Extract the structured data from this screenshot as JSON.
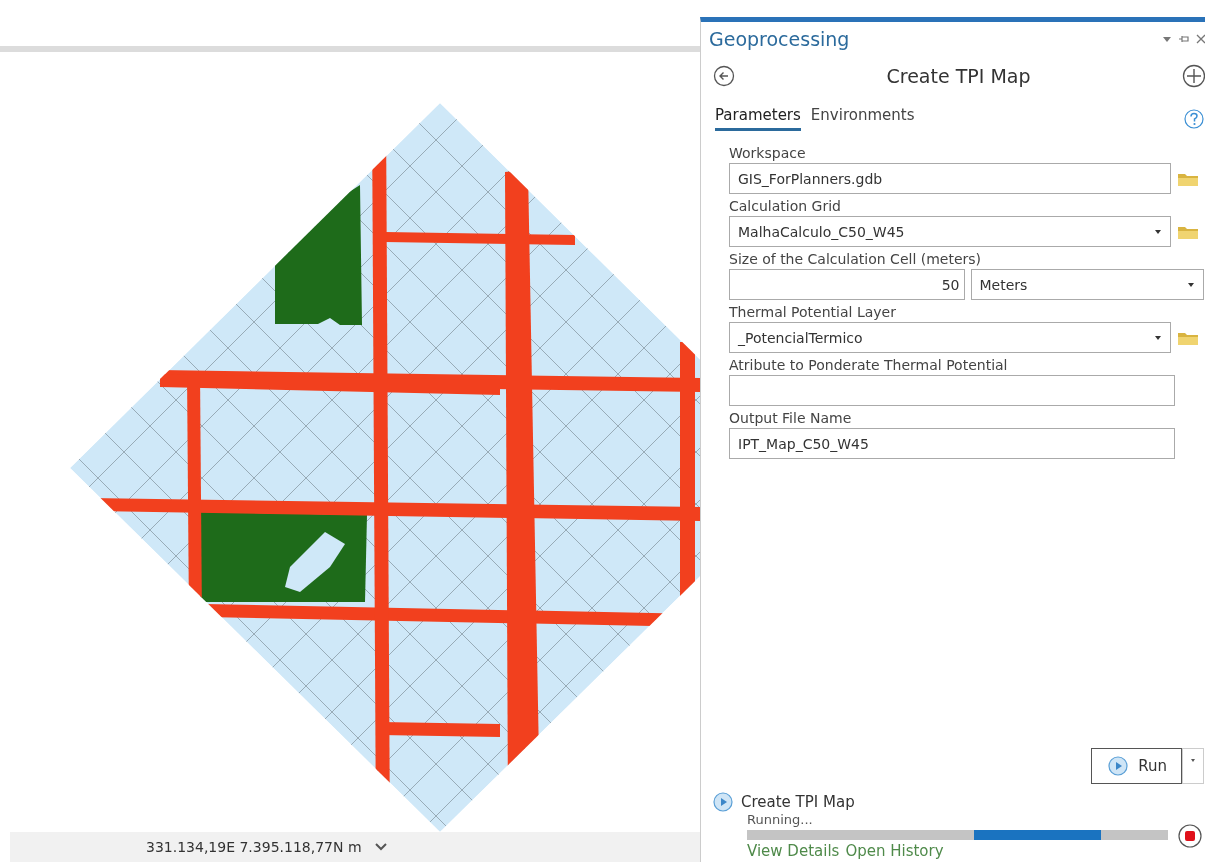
{
  "map": {
    "coordinates": "331.134,19E 7.395.118,77N m"
  },
  "panel": {
    "title": "Geoprocessing",
    "tool_title": "Create TPI Map",
    "tabs": [
      {
        "label": "Parameters",
        "selected": true
      },
      {
        "label": "Environments",
        "selected": false
      }
    ],
    "parameters": [
      {
        "kind": "text-browse",
        "label": "Workspace",
        "value": "GIS_ForPlanners.gdb"
      },
      {
        "kind": "dropdown-browse",
        "label": "Calculation Grid",
        "value": "MalhaCalculo_C50_W45"
      },
      {
        "kind": "number-unit",
        "label": "Size of the Calculation Cell (meters)",
        "value": "50",
        "unit": "Meters"
      },
      {
        "kind": "dropdown-browse",
        "label": "Thermal Potential Layer",
        "value": "_PotencialTermico"
      },
      {
        "kind": "text",
        "label": "Atribute to Ponderate Thermal Potential"
      },
      {
        "kind": "text",
        "label": "Output File Name",
        "value": "IPT_Map_C50_W45"
      }
    ],
    "run_button": "Run",
    "job": {
      "name": "Create TPI Map",
      "status": "Running...",
      "level": 0.84,
      "links": [
        "View Details",
        "Open History"
      ]
    }
  }
}
